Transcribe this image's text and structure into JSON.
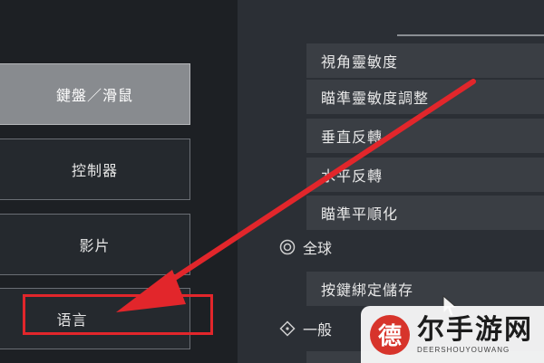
{
  "left_menu": {
    "items": [
      {
        "label": "鍵盤／滑鼠",
        "active": true
      },
      {
        "label": "控制器",
        "active": false
      },
      {
        "label": "影片",
        "active": false
      },
      {
        "label": "语言",
        "active": false
      }
    ]
  },
  "settings": {
    "rows_top": [
      {
        "label": "視角靈敏度"
      },
      {
        "label": "瞄準靈敏度調整"
      },
      {
        "label": "垂直反轉"
      },
      {
        "label": "水平反轉"
      },
      {
        "label": "瞄準平順化"
      }
    ],
    "sections": [
      {
        "title": "全球",
        "icon": "globe-icon"
      },
      {
        "title": "一般",
        "icon": "diamond-icon"
      }
    ],
    "global_rows": [
      {
        "label": "按鍵綁定儲存"
      }
    ]
  },
  "annotation": {
    "arrow_color": "#e2262b",
    "highlight_color": "#e2262b"
  },
  "watermark": {
    "logo_char": "德",
    "title": "尔手游网",
    "subtitle": "DEERSHOUYOUWANG"
  }
}
